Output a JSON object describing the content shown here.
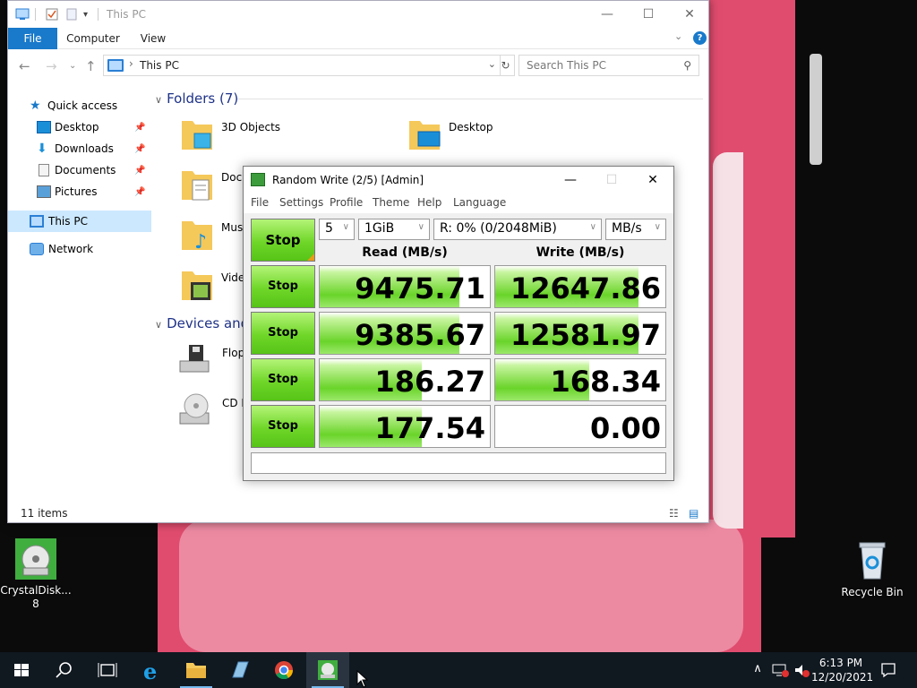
{
  "explorer": {
    "title": "This PC",
    "ribbon_tabs": [
      "File",
      "Computer",
      "View"
    ],
    "address": "This PC",
    "search_placeholder": "Search This PC",
    "nav": {
      "quick_access": "Quick access",
      "items": [
        "Desktop",
        "Downloads",
        "Documents",
        "Pictures"
      ],
      "this_pc": "This PC",
      "network": "Network"
    },
    "folders_header": "Folders (7)",
    "folders": [
      "3D Objects",
      "Desktop",
      "Docum",
      "Music",
      "Videos"
    ],
    "devices_header": "Devices and",
    "devices": [
      "Floppy",
      "CD Dri"
    ],
    "status": "11 items"
  },
  "cdm": {
    "title": "Random Write (2/5) [Admin]",
    "menu": [
      "File",
      "Settings",
      "Profile",
      "Theme",
      "Help",
      "Language"
    ],
    "all_button": "Stop",
    "count": "5",
    "size": "1GiB",
    "drive": "R: 0% (0/2048MiB)",
    "unit": "MB/s",
    "read_header": "Read (MB/s)",
    "write_header": "Write (MB/s)",
    "rows": [
      {
        "button": "Stop",
        "read": "9475.71",
        "write": "12647.86",
        "read_fill": 0.82,
        "write_fill": 0.84
      },
      {
        "button": "Stop",
        "read": "9385.67",
        "write": "12581.97",
        "read_fill": 0.82,
        "write_fill": 0.84
      },
      {
        "button": "Stop",
        "read": "186.27",
        "write": "168.34",
        "read_fill": 0.6,
        "write_fill": 0.55
      },
      {
        "button": "Stop",
        "read": "177.54",
        "write": "0.00",
        "read_fill": 0.6,
        "write_fill": 0.0
      }
    ]
  },
  "desktop": {
    "icons": [
      {
        "label_line1": "CrystalDisk...",
        "label_line2": "8"
      },
      {
        "label_line1": "Recycle Bin",
        "label_line2": ""
      }
    ]
  },
  "taskbar": {
    "time": "6:13 PM",
    "date": "12/20/2021"
  },
  "colors": {
    "accent": "#1979ca",
    "cdm_green": "#6fd628",
    "wallpaper_pink": "#e04c6e"
  }
}
